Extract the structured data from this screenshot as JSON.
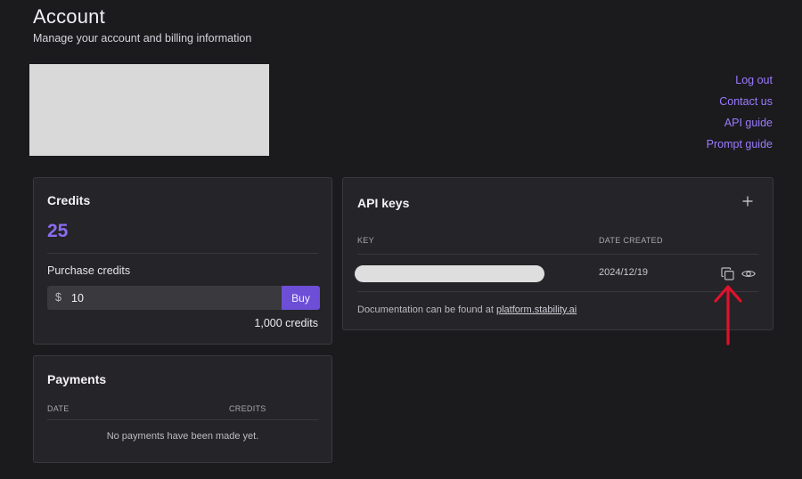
{
  "header": {
    "title": "Account",
    "subtitle": "Manage your account and billing information"
  },
  "links": {
    "logout": "Log out",
    "contact": "Contact us",
    "api_guide": "API guide",
    "prompt_guide": "Prompt guide"
  },
  "credits": {
    "heading": "Credits",
    "balance": "25",
    "purchase_label": "Purchase credits",
    "currency_symbol": "$",
    "amount_value": "10",
    "buy_label": "Buy",
    "credits_amount": "1,000 credits"
  },
  "api_keys": {
    "heading": "API keys",
    "add_icon": "plus-icon",
    "columns": {
      "key": "KEY",
      "date_created": "DATE CREATED"
    },
    "rows": [
      {
        "key": "",
        "date_created": "2024/12/19",
        "copy_icon": "copy-icon",
        "view_icon": "eye-icon"
      }
    ],
    "doc_prefix": "Documentation can be found at ",
    "doc_link": "platform.stability.ai"
  },
  "payments": {
    "heading": "Payments",
    "columns": {
      "date": "DATE",
      "credits": "CREDITS"
    },
    "empty_message": "No payments have been made yet."
  },
  "colors": {
    "background": "#1b1a1d",
    "card": "#252428",
    "accent": "#8b6cf0",
    "link": "#9b7bff",
    "buy_button": "#6c4fd6",
    "annotation_arrow": "#e0112b"
  }
}
